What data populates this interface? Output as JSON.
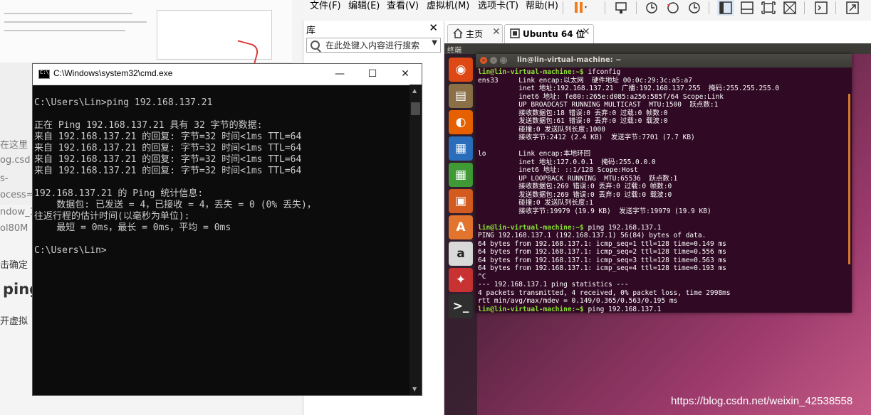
{
  "cmd": {
    "title": "C:\\Windows\\system32\\cmd.exe",
    "lines": [
      "C:\\Users\\Lin>ping 192.168.137.21",
      "",
      "正在 Ping 192.168.137.21 具有 32 字节的数据:",
      "来自 192.168.137.21 的回复: 字节=32 时间<1ms TTL=64",
      "来自 192.168.137.21 的回复: 字节=32 时间<1ms TTL=64",
      "来自 192.168.137.21 的回复: 字节=32 时间<1ms TTL=64",
      "来自 192.168.137.21 的回复: 字节=32 时间<1ms TTL=64",
      "",
      "192.168.137.21 的 Ping 统计信息:",
      "    数据包: 已发送 = 4，已接收 = 4，丢失 = 0 (0% 丢失)，",
      "往返行程的估计时间(以毫秒为单位):",
      "    最短 = 0ms，最长 = 0ms，平均 = 0ms",
      "",
      "C:\\Users\\Lin>"
    ]
  },
  "menubar": {
    "items": [
      "文件(F)",
      "编辑(E)",
      "查看(V)",
      "虚拟机(M)",
      "选项卡(T)",
      "帮助(H)"
    ]
  },
  "library": {
    "title": "库",
    "close": "✕",
    "search_placeholder": "在此处键入内容进行搜索"
  },
  "tabs": [
    {
      "label": "主页",
      "icon": "home-icon"
    },
    {
      "label": "Ubuntu 64 位",
      "icon": "vm-icon"
    }
  ],
  "vm": {
    "topbar_label": "终端",
    "terminal_title": "lin@lin-virtual-machine: ~",
    "prompt": "lin@lin-virtual-machine:~$",
    "commands": [
      "ifconfig",
      "ping 192.168.137.1",
      "ping 192.168.137.1"
    ],
    "ifconfig_lines": [
      "ens33     Link encap:以太网  硬件地址 00:0c:29:3c:a5:a7",
      "          inet 地址:192.168.137.21  广播:192.168.137.255  掩码:255.255.255.0",
      "          inet6 地址: fe80::265e:d085:a256:585f/64 Scope:Link",
      "          UP BROADCAST RUNNING MULTICAST  MTU:1500  跃点数:1",
      "          接收数据包:18 错误:0 丢弃:0 过载:0 帧数:0",
      "          发送数据包:61 错误:0 丢弃:0 过载:0 载波:0",
      "          碰撞:0 发送队列长度:1000",
      "          接收字节:2412 (2.4 KB)  发送字节:7701 (7.7 KB)",
      "",
      "lo        Link encap:本地环回",
      "          inet 地址:127.0.0.1  掩码:255.0.0.0",
      "          inet6 地址: ::1/128 Scope:Host",
      "          UP LOOPBACK RUNNING  MTU:65536  跃点数:1",
      "          接收数据包:269 错误:0 丢弃:0 过载:0 帧数:0",
      "          发送数据包:269 错误:0 丢弃:0 过载:0 载波:0",
      "          碰撞:0 发送队列长度:1",
      "          接收字节:19979 (19.9 KB)  发送字节:19979 (19.9 KB)",
      ""
    ],
    "ping_lines": [
      "PING 192.168.137.1 (192.168.137.1) 56(84) bytes of data.",
      "64 bytes from 192.168.137.1: icmp_seq=1 ttl=128 time=0.149 ms",
      "64 bytes from 192.168.137.1: icmp_seq=2 ttl=128 time=0.556 ms",
      "64 bytes from 192.168.137.1: icmp_seq=3 ttl=128 time=0.563 ms",
      "64 bytes from 192.168.137.1: icmp_seq=4 ttl=128 time=0.193 ms",
      "^C",
      "--- 192.168.137.1 ping statistics ---",
      "4 packets transmitted, 4 received, 0% packet loss, time 2998ms",
      "rtt min/avg/max/mdev = 0.149/0.365/0.563/0.195 ms"
    ],
    "launcher": [
      {
        "name": "ubuntu-dash-icon",
        "glyph": "◉",
        "color": "#dd4814"
      },
      {
        "name": "files-icon",
        "glyph": "▤",
        "color": "#8b6f47"
      },
      {
        "name": "firefox-icon",
        "glyph": "◐",
        "color": "#e66000"
      },
      {
        "name": "writer-icon",
        "glyph": "▦",
        "color": "#2a6ebb"
      },
      {
        "name": "calc-icon",
        "glyph": "▦",
        "color": "#3f9a36"
      },
      {
        "name": "impress-icon",
        "glyph": "▣",
        "color": "#d35b1f"
      },
      {
        "name": "software-center-icon",
        "glyph": "A",
        "color": "#e2742e"
      },
      {
        "name": "amazon-icon",
        "glyph": "a",
        "color": "#d9d9d9"
      },
      {
        "name": "settings-icon",
        "glyph": "✦",
        "color": "#c83232"
      },
      {
        "name": "terminal-icon",
        "glyph": ">_",
        "color": "#2f2f2f"
      }
    ]
  },
  "background": {
    "fragments": [
      "在这里",
      "og.csd",
      "s-",
      "ocess=",
      "ndow_1",
      "ol80M",
      "击确定",
      "ping",
      "开虚拟"
    ]
  },
  "watermark": "https://blog.csdn.net/weixin_42538558"
}
